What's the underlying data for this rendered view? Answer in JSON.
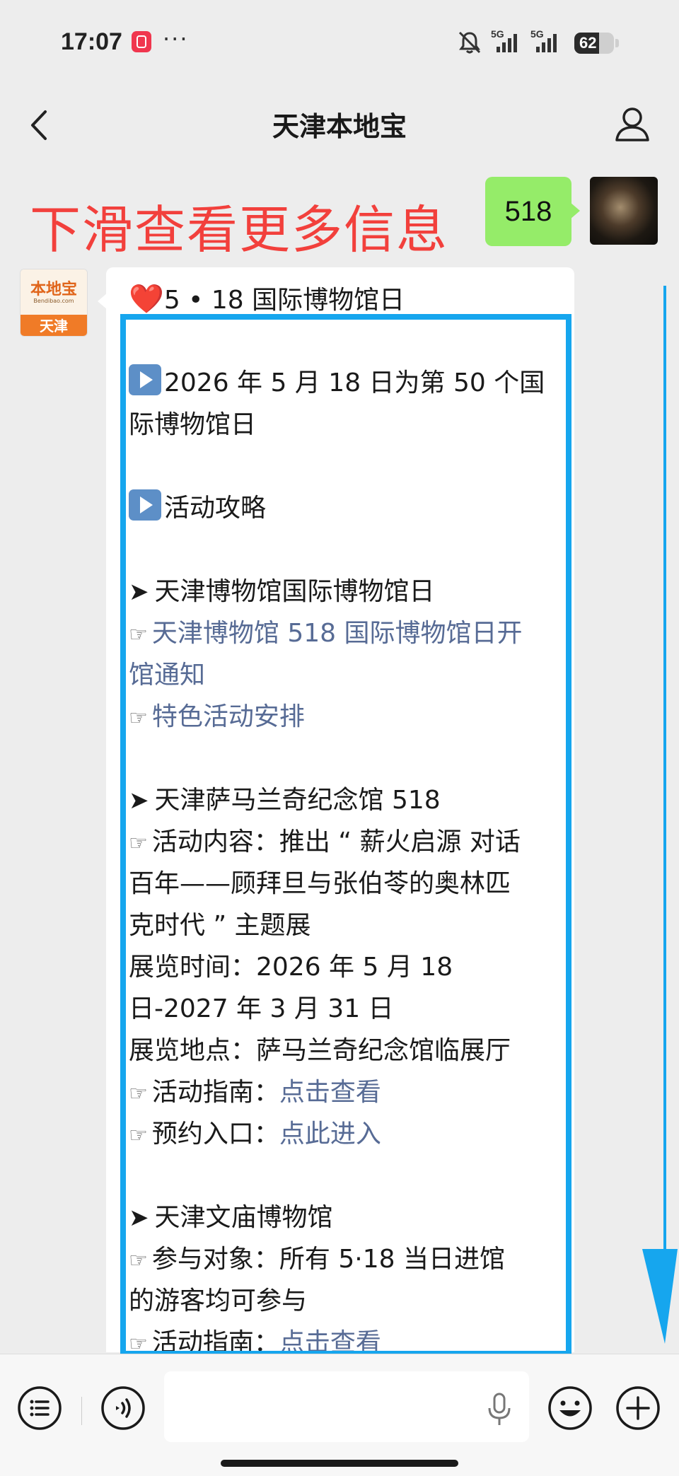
{
  "status": {
    "time": "17:07",
    "dots": "···",
    "signal_label": "5G",
    "battery": "62",
    "battery_level": 0.62
  },
  "nav": {
    "title": "天津本地宝",
    "back_icon": "chevron-left-icon",
    "profile_icon": "person-icon"
  },
  "overlay": {
    "hint": "下滑查看更多信息"
  },
  "my_message": {
    "text": "518"
  },
  "bot_avatar": {
    "brand": "本地宝",
    "url": "Bendibao.com",
    "city": "天津"
  },
  "message": {
    "heading_emoji": "❤️",
    "heading": "5 • 18 国际博物馆日",
    "intro_a": "2026 年 5 月 18 日为第 50 个国",
    "intro_b": "际博物馆日",
    "guide": "活动攻略",
    "arrow": "➤",
    "hand": "☞",
    "s1_title": "天津博物馆国际博物馆日",
    "s1_link1_a": "天津博物馆 518 国际博物馆日开",
    "s1_link1_b": "馆通知",
    "s1_link2": "特色活动安排",
    "s2_title": "天津萨马兰奇纪念馆 518",
    "s2_content_a": "活动内容：推出 “ 薪火启源 对话",
    "s2_content_b": "百年——顾拜旦与张伯苓的奥林匹",
    "s2_content_c": "克时代 ” 主题展",
    "s2_time_a": "展览时间：2026 年 5 月 18",
    "s2_time_b": "日-2027 年 3 月 31 日",
    "s2_place": "展览地点：萨马兰奇纪念馆临展厅",
    "s2_guide_label": "活动指南：",
    "s2_guide_link": "点击查看",
    "s2_booking_label": "预约入口：",
    "s2_booking_link": "点此进入",
    "s3_title": "天津文庙博物馆",
    "s3_target_a": "参与对象：所有 5·18 当日进馆",
    "s3_target_b": "的游客均可参与",
    "s3_guide_label": "活动指南：",
    "s3_guide_link": "点击查看"
  },
  "input_bar": {
    "menu_icon": "list-menu-icon",
    "voice_icon": "voice-icon",
    "mic_icon": "microphone-icon",
    "emoji_icon": "emoji-icon",
    "plus_icon": "plus-icon",
    "placeholder": ""
  },
  "colors": {
    "hint_red": "#f2403c",
    "my_bubble": "#95ec69",
    "link": "#576b95",
    "highlight": "#16a6ee"
  }
}
